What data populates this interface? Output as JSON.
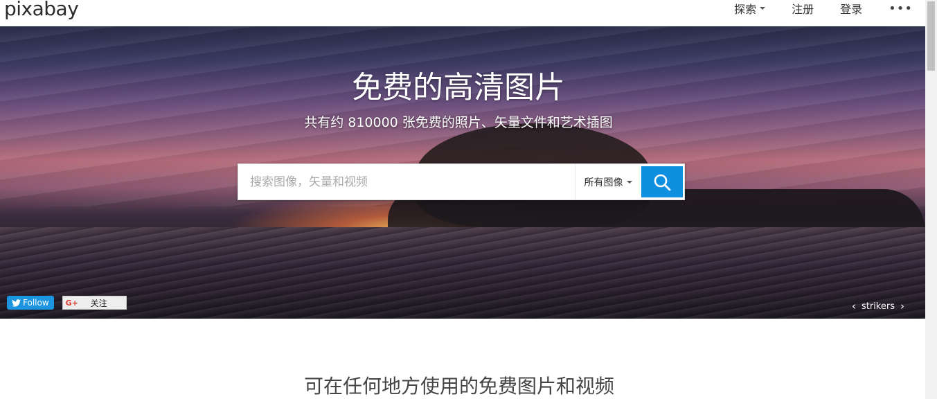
{
  "header": {
    "logo": "pixabay",
    "nav": [
      {
        "label": "探索"
      },
      {
        "label": "注册"
      },
      {
        "label": "登录"
      },
      {
        "label": "•••"
      }
    ]
  },
  "hero": {
    "title": "免费的高清图片",
    "subtitle": "共有约 810000 张免费的照片、矢量文件和艺术插图",
    "search": {
      "placeholder": "搜索图像，矢量和视频",
      "value": "",
      "type_selected": "所有图像"
    },
    "social": {
      "twitter_label": "Follow",
      "gplus_label": "关注",
      "gplus_icon": "G+"
    },
    "credit": {
      "prev": "‹",
      "author": "strikers",
      "next": "›"
    }
  },
  "main": {
    "heading": "可在任何地方使用的免费图片和视频"
  },
  "colors": {
    "search_button": "#0f8fe0",
    "twitter": "#1b95e0"
  }
}
